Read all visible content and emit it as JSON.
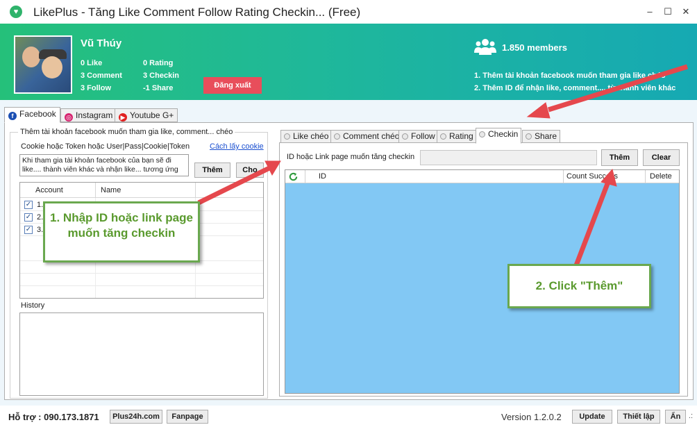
{
  "window": {
    "title": "LikePlus - Tăng Like Comment Follow Rating Checkin... (Free)",
    "min_glyph": "–",
    "max_glyph": "☐",
    "close_glyph": "✕"
  },
  "profile": {
    "name": "Vũ Thúy",
    "stats": [
      "0 Like",
      "0 Rating",
      "3 Comment",
      "3 Checkin",
      "3 Follow",
      "-1 Share"
    ],
    "logout_label": "Đăng xuất"
  },
  "community": {
    "members": "1.850 members",
    "note1": "1. Thêm tài khoản facebook muốn tham gia like chéo",
    "note2": "2. Thêm ID để nhận like, comment.... từ thành viên khác"
  },
  "platform_tabs": [
    {
      "label": "Facebook",
      "icon": "facebook-icon",
      "color": "#1b4fb3"
    },
    {
      "label": "Instagram",
      "icon": "instagram-icon",
      "color": "#d6236f"
    },
    {
      "label": "Youtube G+",
      "icon": "youtube-icon",
      "color": "#e02020"
    }
  ],
  "account_panel": {
    "group_title": "Thêm tài khoản facebook muốn tham gia like, comment... chéo",
    "field_label": "Cookie hoặc Token hoặc User|Pass|Cookie|Token",
    "howto_link": "Cách lấy cookie",
    "input_text": "Khi tham gia tài khoản facebook của bạn sẽ đi like.... thành viên khác và nhận like... tương ứng",
    "add_label": "Thêm",
    "second_label": "Chọ",
    "columns": [
      "Account",
      "Name"
    ],
    "rows": [
      {
        "account": "1.",
        "name": ""
      },
      {
        "account": "2.",
        "name": ""
      },
      {
        "account": "3.",
        "name": ""
      }
    ],
    "history_label": "History"
  },
  "feature_tabs": [
    "Like chéo",
    "Comment chéo",
    "Follow",
    "Rating",
    "Checkin",
    "Share"
  ],
  "checkin": {
    "label": "ID hoặc Link page muốn tăng checkin",
    "input_value": "",
    "add_label": "Thêm",
    "clear_label": "Clear",
    "columns": [
      "ID",
      "Count Success",
      "Delete"
    ]
  },
  "callouts": {
    "step1": "1. Nhập ID hoặc link page muốn tăng checkin",
    "step2": "2. Click \"Thêm\""
  },
  "footer": {
    "support": "Hỗ trợ : 090.173.1871",
    "site_label": "Plus24h.com",
    "fanpage_label": "Fanpage",
    "version": "Version 1.2.0.2",
    "update_label": "Update",
    "settings_label": "Thiết lập",
    "hide_label": "Ẩn",
    "grip": ".:"
  },
  "colors": {
    "accent_green": "#25c07a",
    "logout_red": "#e84e5b",
    "grid_blue": "#82c8f4",
    "arrow_red": "#e5484d",
    "callout_green": "#6aa84f"
  }
}
